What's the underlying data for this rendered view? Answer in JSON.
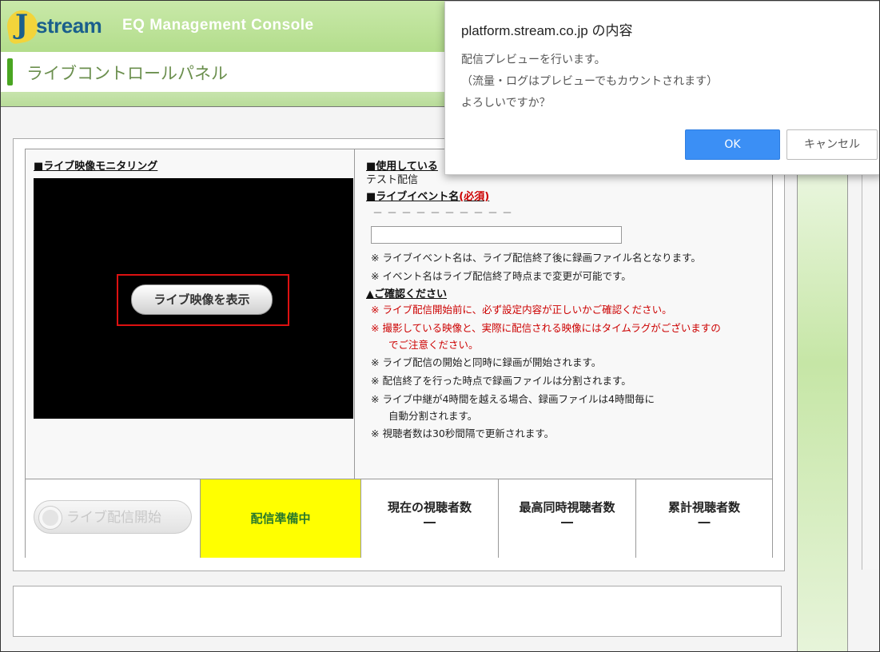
{
  "header": {
    "logo_j": "J",
    "logo_text": "stream",
    "app_title": "EQ Management Console",
    "page_title": "ライブコントロールパネル"
  },
  "monitor": {
    "heading": "■ライブ映像モニタリング",
    "show_button": "ライブ映像を表示"
  },
  "info": {
    "using_heading": "■使用している",
    "using_value": "テスト配信",
    "event_heading": "■ライブイベント名",
    "event_required": "(必須)",
    "event_dashes": "－－－－－－－－－－",
    "event_input_value": "",
    "notes": [
      "※ ライブイベント名は、ライブ配信終了後に録画ファイル名となります。",
      "※ イベント名はライブ配信終了時点まで変更が可能です。"
    ],
    "confirm_heading": "▲ご確認ください",
    "red_notes": [
      "※ ライブ配信開始前に、必ず設定内容が正しいかご確認ください。",
      "※ 撮影している映像と、実際に配信される映像にはタイムラグがございますの",
      "でご注意ください。"
    ],
    "more_notes": [
      "※ ライブ配信の開始と同時に録画が開始されます。",
      "※ 配信終了を行った時点で録画ファイルは分割されます。",
      "※ ライブ中継が4時間を越える場合、録画ファイルは4時間毎に",
      "自動分割されます。",
      "※ 視聴者数は30秒間隔で更新されます。"
    ]
  },
  "status": {
    "start_button": "ライブ配信開始",
    "state": "配信準備中",
    "current_label": "現在の視聴者数",
    "current_value": "―",
    "peak_label": "最高同時視聴者数",
    "peak_value": "―",
    "total_label": "累計視聴者数",
    "total_value": "―"
  },
  "dialog": {
    "title": "platform.stream.co.jp の内容",
    "lines": [
      "配信プレビューを行います。",
      "（流量・ログはプレビューでもカウントされます）",
      "よろしいですか？"
    ],
    "ok": "OK",
    "cancel": "キャンセル"
  },
  "colors": {
    "accent_green": "#49a521",
    "header_green": "#b3dd8c",
    "status_yellow": "#ffff00",
    "ok_blue": "#3b8ff5",
    "warning_red": "#cc0000"
  }
}
